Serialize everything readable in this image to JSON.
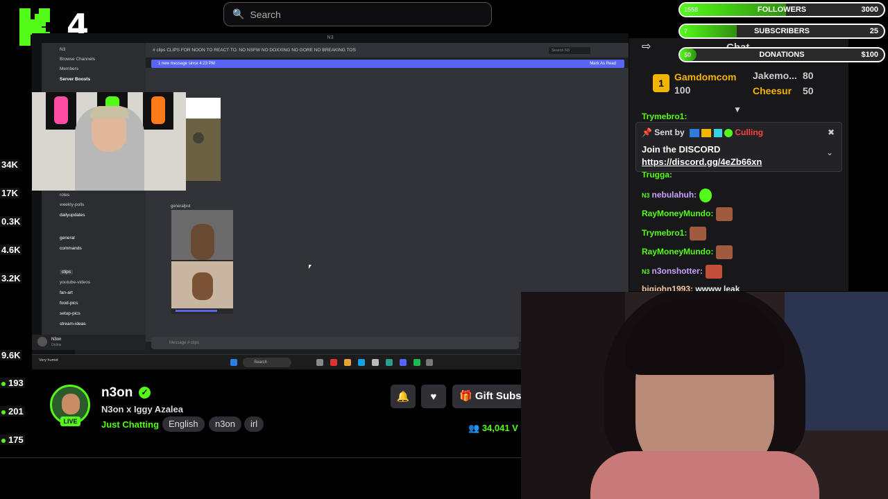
{
  "kick_logo_letter": "K",
  "kick_logo_number": "4",
  "search": {
    "placeholder": "Search"
  },
  "left_stats": [
    "34K",
    "17K",
    "0.3K",
    "4.6K",
    "3.2K",
    "9.6K",
    "193",
    "201",
    "175"
  ],
  "discord": {
    "server_name": "N3",
    "channel_topic": "# clips  CLIPS FOR NOON TO REACT TO. NO NSFW NO DOXXING NO GORE NO BREAKING TOS",
    "new_messages": "1 new message since 4:23 PM",
    "mark_as_read": "Mark As Read",
    "search_placeholder": "Search N3",
    "sidebar_items": [
      "Browse Channels",
      "Members",
      "Server Boosts"
    ],
    "channels": [
      "roles",
      "weekly-polls",
      "dailyupdates",
      "general",
      "commands",
      "clips",
      "youtube-videos",
      "fan-art",
      "food-pics",
      "setup-pics",
      "stream-ideas"
    ],
    "clip_author": "generalpot",
    "composer_placeholder": "Message # clips",
    "user_name": "N3on",
    "user_status": "Online",
    "taskbar_search": "Search",
    "weather": "Very humid"
  },
  "streamer": {
    "name": "n3on",
    "live_label": "LIVE",
    "title": "N3on x Iggy Azalea",
    "category": "Just Chatting",
    "tags": [
      "English",
      "n3on",
      "irl"
    ],
    "gift_label": "Gift Subs",
    "viewers": "34,041 V"
  },
  "goals": [
    {
      "label": "FOLLOWERS",
      "current": "1558",
      "target": "3000",
      "fill": 0.52
    },
    {
      "label": "SUBSCRIBERS",
      "current": "7",
      "target": "25",
      "fill": 0.28
    },
    {
      "label": "DONATIONS",
      "current": "$0",
      "target": "$100",
      "fill": 0.02
    }
  ],
  "chat": {
    "header": "Chat",
    "leaderboard": [
      {
        "rank": "1",
        "name": "Gamdomcom",
        "amount": "100"
      },
      {
        "name": "Jakemo...",
        "amount": "80"
      },
      {
        "name": "Cheesur",
        "amount": "50"
      }
    ],
    "pinned": {
      "sent_by": "Sent by",
      "sender": "Culling",
      "text": "Join the DISCORD",
      "link": "https://discord.gg/4eZb66xn"
    },
    "partial_top": "Trymebro1:",
    "partial_mid": "Trugga:",
    "messages": [
      {
        "user": "nebulahuh:",
        "color": "#c9a0ff",
        "text": ""
      },
      {
        "user": "RayMoneyMundo:",
        "color": "#53fc18",
        "text": ""
      },
      {
        "user": "Trymebro1:",
        "color": "#53fc18",
        "text": ""
      },
      {
        "user": "RayMoneyMundo:",
        "color": "#53fc18",
        "text": ""
      },
      {
        "user": "n3onshotter:",
        "color": "#c9a0ff",
        "text": ""
      },
      {
        "user": "bigjohn1993:",
        "color": "#f5c6a0",
        "text": "wwww leak"
      }
    ]
  },
  "colors": {
    "kick_green": "#53fc18",
    "bg": "#000000",
    "discord_blurple": "#5865f2"
  }
}
